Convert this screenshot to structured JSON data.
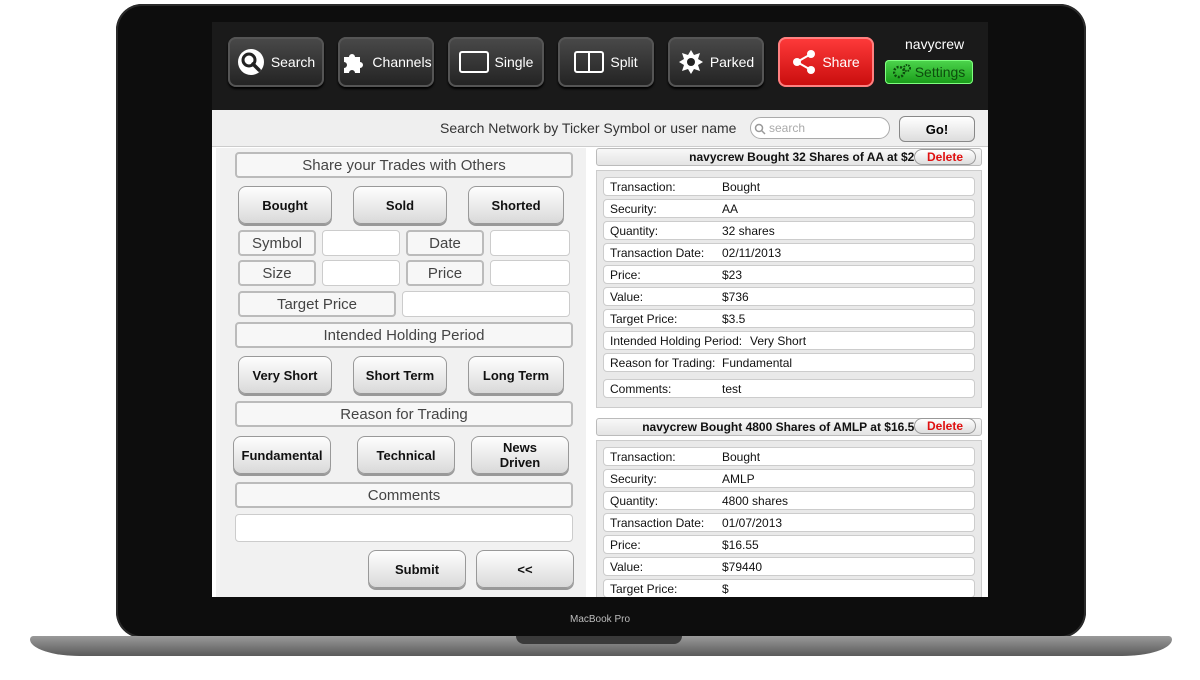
{
  "device": {
    "label": "MacBook Pro"
  },
  "nav": {
    "buttons": [
      {
        "label": "Search",
        "icon": "search-icon"
      },
      {
        "label": "Channels",
        "icon": "puzzle-icon"
      },
      {
        "label": "Single",
        "icon": "single-pane-icon"
      },
      {
        "label": "Split",
        "icon": "split-pane-icon"
      },
      {
        "label": "Parked",
        "icon": "gear-icon"
      },
      {
        "label": "Share",
        "icon": "share-icon"
      }
    ],
    "username": "navycrew",
    "settings_label": "Settings",
    "share_color": "#e81a1a",
    "settings_color": "#2bb52b"
  },
  "search": {
    "label": "Search Network by Ticker Symbol or user name",
    "placeholder": "search",
    "go_label": "Go!"
  },
  "form": {
    "title": "Share your Trades with Others",
    "transaction_buttons": [
      "Bought",
      "Sold",
      "Shorted"
    ],
    "symbol_label": "Symbol",
    "date_label": "Date",
    "size_label": "Size",
    "price_label": "Price",
    "target_price_label": "Target Price",
    "holding_title": "Intended Holding Period",
    "holding_buttons": [
      "Very Short",
      "Short Term",
      "Long Term"
    ],
    "reason_title": "Reason for Trading",
    "reason_buttons": [
      "Fundamental",
      "Technical",
      "News Driven"
    ],
    "comments_title": "Comments",
    "submit_label": "Submit",
    "back_label": "<<"
  },
  "trades": [
    {
      "title": "navycrew Bought 32 Shares of AA at $23",
      "delete_label": "Delete",
      "rows": [
        {
          "key": "Transaction:",
          "value": "Bought"
        },
        {
          "key": "Security:",
          "value": "AA"
        },
        {
          "key": "Quantity:",
          "value": "32 shares"
        },
        {
          "key": "Transaction Date:",
          "value": "02/11/2013"
        },
        {
          "key": "Price:",
          "value": "$23"
        },
        {
          "key": "Value:",
          "value": "$736"
        },
        {
          "key": "Target Price:",
          "value": "$3.5"
        },
        {
          "key": "Intended Holding Period:",
          "value": "Very Short"
        },
        {
          "key": "Reason for Trading:",
          "value": "Fundamental"
        },
        {
          "key": "Comments:",
          "value": "test"
        }
      ]
    },
    {
      "title": "navycrew Bought 4800 Shares of AMLP at $16.55",
      "delete_label": "Delete",
      "rows": [
        {
          "key": "Transaction:",
          "value": "Bought"
        },
        {
          "key": "Security:",
          "value": "AMLP"
        },
        {
          "key": "Quantity:",
          "value": "4800 shares"
        },
        {
          "key": "Transaction Date:",
          "value": "01/07/2013"
        },
        {
          "key": "Price:",
          "value": "$16.55"
        },
        {
          "key": "Value:",
          "value": "$79440"
        },
        {
          "key": "Target Price:",
          "value": "$"
        }
      ]
    }
  ]
}
